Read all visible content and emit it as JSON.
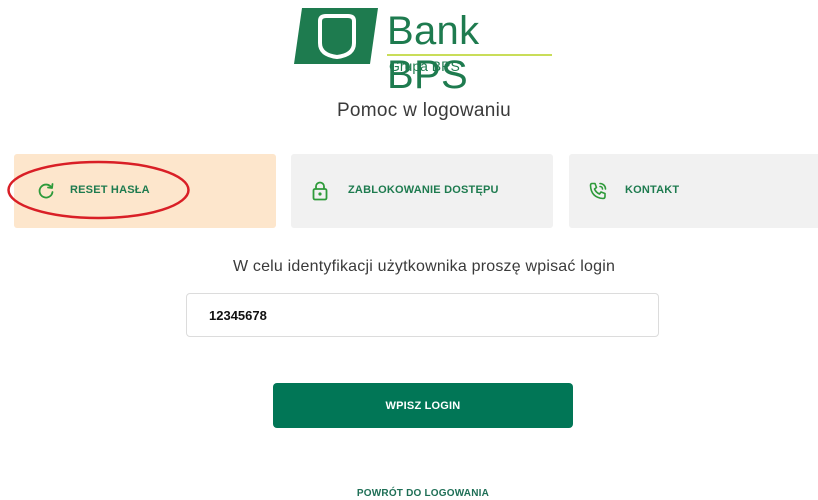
{
  "brand": {
    "name": "Bank BPS",
    "sub": "Grupa BPS",
    "colors": {
      "primary": "#1e7b4f",
      "accent_line": "#c9dd59",
      "button": "#017656"
    }
  },
  "page": {
    "title": "Pomoc w logowaniu"
  },
  "tabs": [
    {
      "label": "RESET HASŁA",
      "icon": "refresh-icon",
      "active": true
    },
    {
      "label": "ZABLOKOWANIE DOSTĘPU",
      "icon": "lock-icon",
      "active": false
    },
    {
      "label": "KONTAKT",
      "icon": "phone-icon",
      "active": false
    }
  ],
  "form": {
    "instruction": "W celu identyfikacji użytkownika proszę wpisać login",
    "login_value": "12345678",
    "submit_label": "WPISZ LOGIN"
  },
  "footer": {
    "back_label": "POWRÓT DO LOGOWANIA"
  }
}
